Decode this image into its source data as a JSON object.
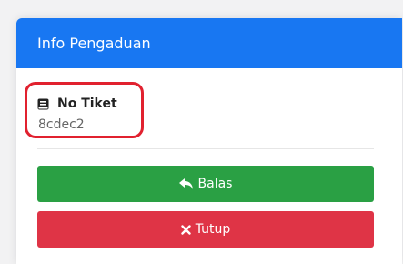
{
  "card": {
    "header_title": "Info Pengaduan"
  },
  "ticket": {
    "label": "No Tiket",
    "value": "8cdec2",
    "icon": "book-icon"
  },
  "buttons": {
    "reply": {
      "label": "Balas",
      "icon": "reply-icon",
      "color": "#2aa044"
    },
    "close": {
      "label": "Tutup",
      "icon": "close-icon",
      "color": "#df3446"
    }
  },
  "colors": {
    "header": "#1877f2",
    "highlight_outline": "#e1212f"
  }
}
